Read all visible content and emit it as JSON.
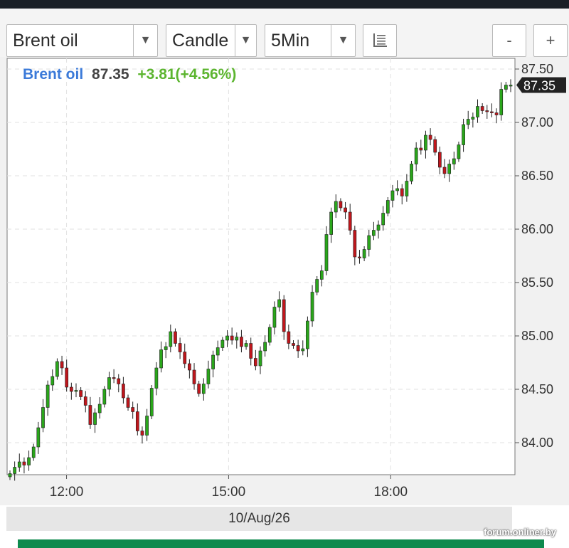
{
  "toolbar": {
    "instrument": "Brent oil",
    "chart_type": "Candle",
    "interval": "5Min",
    "list_icon": "list-icon",
    "zoom_out": "-",
    "zoom_in": "+"
  },
  "header": {
    "name": "Brent oil",
    "price": "87.35",
    "change": "+3.81(+4.56%)",
    "name_color": "#3b7ad9",
    "price_color": "#444444",
    "change_color": "#5cb52f"
  },
  "date_label": "10/Aug/26",
  "watermark": "forum.onliner.by",
  "chart_data": {
    "type": "candlestick",
    "title": "Brent oil",
    "last_price": 87.35,
    "last_price_label": "87.35",
    "ylim": [
      83.7,
      87.6
    ],
    "yticks": [
      84.0,
      84.5,
      85.0,
      85.5,
      86.0,
      86.5,
      87.0,
      87.5
    ],
    "ytick_labels": [
      "84.00",
      "84.50",
      "85.00",
      "85.50",
      "86.00",
      "86.50",
      "87.00",
      "87.50"
    ],
    "xlim_hours": [
      10.9,
      20.3
    ],
    "xticks": [
      12,
      15,
      18
    ],
    "xtick_labels": [
      "12:00",
      "15:00",
      "18:00"
    ],
    "grid": true,
    "up_color": "#2aa61b",
    "down_color": "#c0161c",
    "closes": [
      83.71,
      83.77,
      83.82,
      83.79,
      83.86,
      83.96,
      84.14,
      84.33,
      84.54,
      84.62,
      84.76,
      84.7,
      84.52,
      84.48,
      84.49,
      84.43,
      84.35,
      84.17,
      84.28,
      84.36,
      84.5,
      84.61,
      84.6,
      84.55,
      84.42,
      84.33,
      84.29,
      84.11,
      84.07,
      84.25,
      84.51,
      84.7,
      84.87,
      84.9,
      85.04,
      84.93,
      84.85,
      84.74,
      84.68,
      84.55,
      84.46,
      84.55,
      84.69,
      84.82,
      84.89,
      84.96,
      85.0,
      84.96,
      84.99,
      84.9,
      84.93,
      84.79,
      84.72,
      84.86,
      84.94,
      85.08,
      85.27,
      85.34,
      85.04,
      84.93,
      84.91,
      84.86,
      84.88,
      85.14,
      85.41,
      85.53,
      85.61,
      85.95,
      86.16,
      86.26,
      86.2,
      86.16,
      85.99,
      85.74,
      85.73,
      85.81,
      85.94,
      85.99,
      86.04,
      86.15,
      86.27,
      86.36,
      86.38,
      86.31,
      86.45,
      86.61,
      86.76,
      86.74,
      86.88,
      86.84,
      86.72,
      86.58,
      86.52,
      86.61,
      86.66,
      86.79,
      86.98,
      87.03,
      87.05,
      87.15,
      87.11,
      87.1,
      87.09,
      87.07,
      87.31,
      87.35,
      87.35
    ]
  }
}
